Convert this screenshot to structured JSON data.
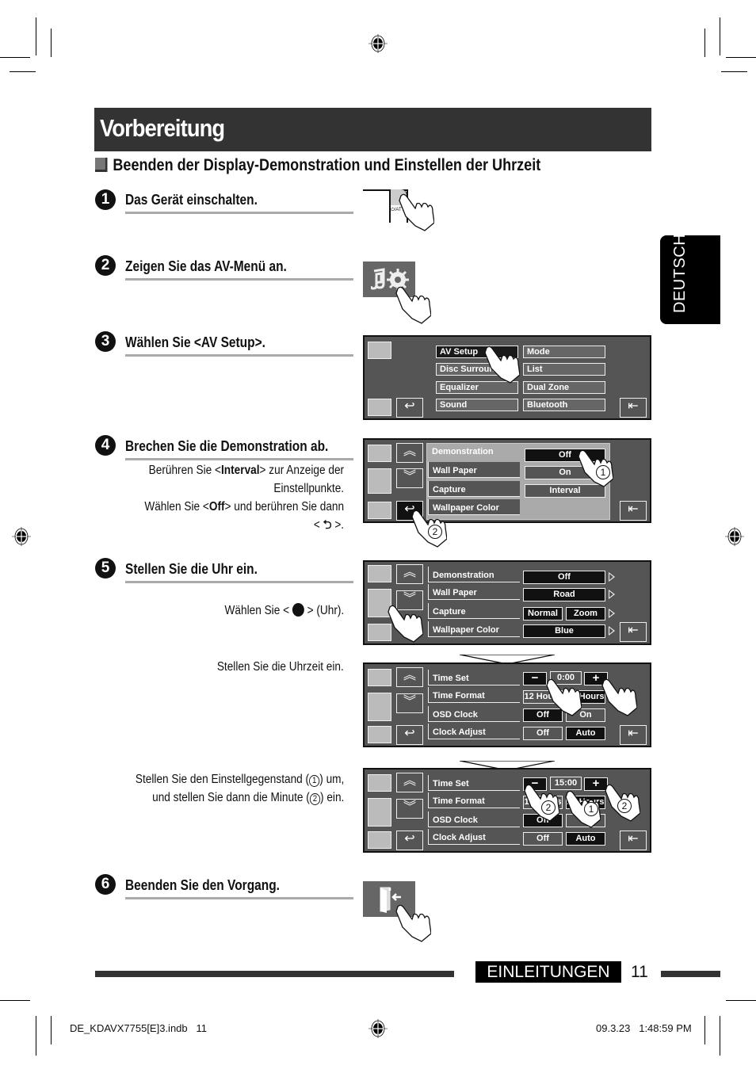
{
  "page": {
    "title": "Vorbereitung",
    "section_heading": "Beenden der Display-Demonstration und Einstellen der Uhrzeit",
    "side_tab": "DEUTSCH",
    "footer_section": "EINLEITUNGEN",
    "page_number": "11"
  },
  "print_marks": {
    "file_name": "DE_KDAVX7755[E]3.indb   11",
    "timestamp": "09.3.23   1:48:59 PM"
  },
  "steps": [
    {
      "num": "1",
      "title": "Das Gerät einschalten.",
      "button_label": "⏻/ATT"
    },
    {
      "num": "2",
      "title": "Zeigen Sie das AV-Menü an.",
      "icon": "av-menu-icon"
    },
    {
      "num": "3",
      "title": "Wählen Sie <AV Setup>."
    },
    {
      "num": "4",
      "title": "Brechen Sie die Demonstration ab.",
      "desc": [
        "Berühren Sie <",
        "Interval",
        "> zur Anzeige der",
        "Einstellpunkte.",
        "Wählen Sie <",
        "Off",
        "> und berühren Sie dann",
        "< ",
        " >."
      ]
    },
    {
      "num": "5",
      "title": "Stellen Sie die Uhr ein.",
      "desc_a": [
        "Wählen Sie < ",
        " > (Uhr)."
      ],
      "desc_b": "Stellen Sie die Uhrzeit ein.",
      "desc_c": [
        "Stellen Sie den Einstellgegenstand (",
        "1",
        ") um,",
        "und stellen Sie dann die Minute (",
        "2",
        ") ein."
      ]
    },
    {
      "num": "6",
      "title": "Beenden Sie den Vorgang.",
      "icon": "exit-icon"
    }
  ],
  "screen_av_menu": {
    "left_col": [
      "AV Setup",
      "Disc Surround",
      "Equalizer",
      "Sound"
    ],
    "right_col": [
      "Mode",
      "List",
      "Dual Zone",
      "Bluetooth"
    ]
  },
  "screen_demo": {
    "rows": [
      "Demonstration",
      "Wall Paper",
      "Capture",
      "Wallpaper Color"
    ],
    "options": [
      "Off",
      "On",
      "Interval"
    ],
    "callouts": [
      "1",
      "2"
    ]
  },
  "screen_display": {
    "rows": [
      {
        "label": "Demonstration",
        "value": "Off"
      },
      {
        "label": "Wall Paper",
        "value": "Road"
      },
      {
        "label": "Capture",
        "values": [
          "Normal",
          "Zoom"
        ]
      },
      {
        "label": "Wallpaper Color",
        "value": "Blue"
      }
    ]
  },
  "screen_clock_1": {
    "rows": [
      "Time Set",
      "Time Format",
      "OSD Clock",
      "Clock Adjust"
    ],
    "time": "0:00",
    "minus": "−",
    "plus": "+",
    "format_options": [
      "12 Hours",
      "24 Hours"
    ],
    "osd_options": [
      "Off",
      "On"
    ],
    "adjust_options": [
      "Off",
      "Auto"
    ]
  },
  "screen_clock_2": {
    "rows": [
      "Time Set",
      "Time Format",
      "OSD Clock",
      "Clock Adjust"
    ],
    "time": "15:00",
    "minus": "−",
    "plus": "+",
    "format_options": [
      "12 Hours",
      "24 Hours"
    ],
    "osd_options": [
      "Off",
      "On"
    ],
    "adjust_options": [
      "Off",
      "Auto"
    ],
    "callouts": [
      "2",
      "1",
      "2"
    ]
  }
}
